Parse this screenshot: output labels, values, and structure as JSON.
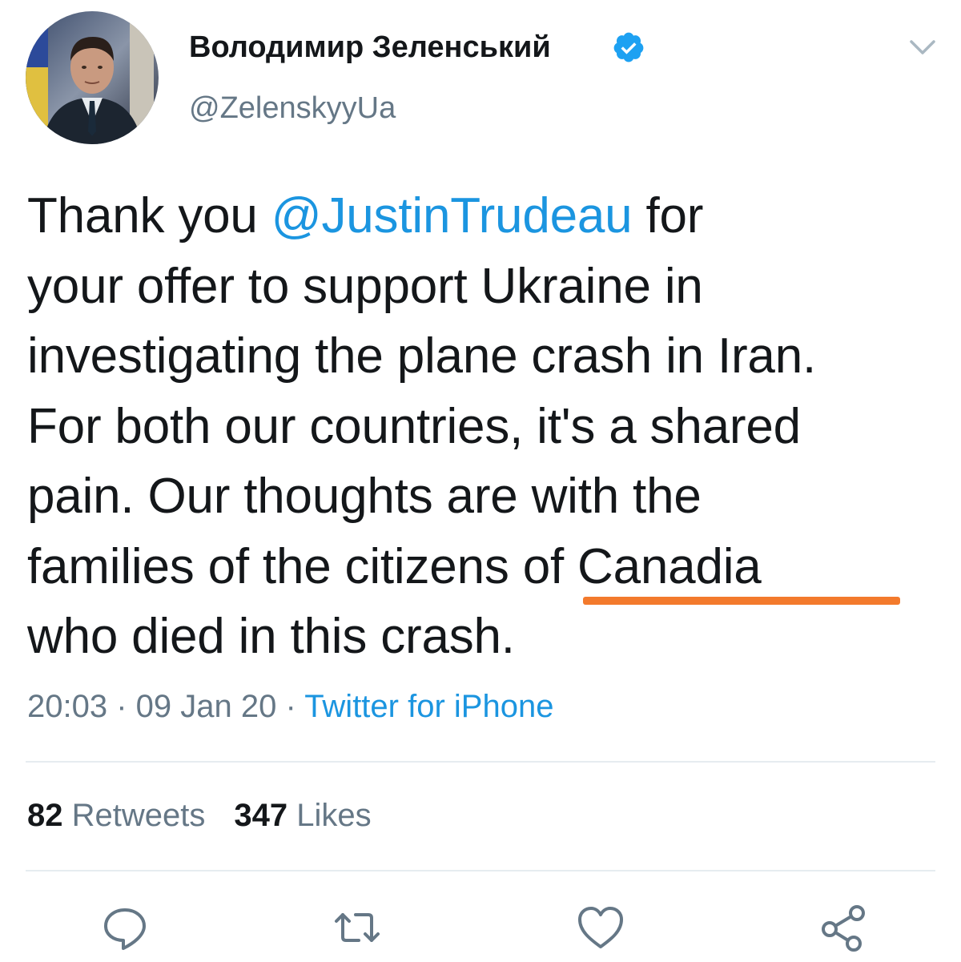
{
  "user": {
    "display_name": "Володимир Зеленський",
    "handle": "@ZelenskyyUa",
    "verified": true,
    "avatar_icon": "profile-photo"
  },
  "tweet": {
    "lines": [
      {
        "before": "Thank you ",
        "mention": "@JustinTrudeau",
        "after": " for"
      },
      {
        "text": "your offer to support Ukraine in"
      },
      {
        "text": "investigating the plane crash in Iran."
      },
      {
        "text": "For both our countries, it's a shared"
      },
      {
        "text": "pain. Our thoughts are with the"
      },
      {
        "text": "families of the citizens of Canadia"
      },
      {
        "text": "who died in this crash."
      }
    ],
    "highlight_color": "#f37a2c"
  },
  "meta": {
    "time": "20:03",
    "separator": " · ",
    "date": "09 Jan 20",
    "source": "Twitter for iPhone"
  },
  "stats": {
    "retweets_count": "82",
    "retweets_label": "Retweets",
    "likes_count": "347",
    "likes_label": "Likes"
  },
  "actions": {
    "reply_icon": "reply-icon",
    "retweet_icon": "retweet-icon",
    "like_icon": "heart-icon",
    "share_icon": "share-icon"
  },
  "colors": {
    "accent": "#1b95e0",
    "text": "#14171a",
    "secondary": "#657786",
    "divider": "#e6ecf0"
  }
}
